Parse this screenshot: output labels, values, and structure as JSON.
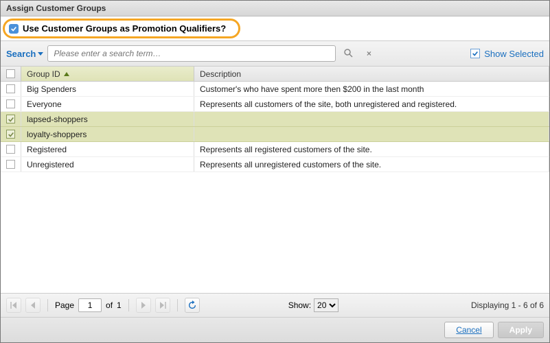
{
  "title": "Assign Customer Groups",
  "qualifier": {
    "checked": true,
    "label": "Use Customer Groups as Promotion Qualifiers?"
  },
  "toolbar": {
    "search_label": "Search",
    "search_placeholder": "Please enter a search term…",
    "show_selected_label": "Show Selected"
  },
  "grid": {
    "headers": {
      "checkbox": "",
      "group_id": "Group ID",
      "description": "Description"
    },
    "sort_column": "group_id",
    "sort_dir": "asc",
    "rows": [
      {
        "selected": false,
        "group_id": "Big Spenders",
        "description": "Customer's who have spent more then $200 in the last month"
      },
      {
        "selected": false,
        "group_id": "Everyone",
        "description": "Represents all customers of the site, both unregistered and registered."
      },
      {
        "selected": true,
        "group_id": "lapsed-shoppers",
        "description": ""
      },
      {
        "selected": true,
        "group_id": "loyalty-shoppers",
        "description": ""
      },
      {
        "selected": false,
        "group_id": "Registered",
        "description": "Represents all registered customers of the site."
      },
      {
        "selected": false,
        "group_id": "Unregistered",
        "description": "Represents all unregistered customers of the site."
      }
    ]
  },
  "pager": {
    "page_label": "Page",
    "page": "1",
    "of_label": "of",
    "total_pages": "1",
    "show_label": "Show:",
    "page_size": "20",
    "displaying": "Displaying 1 - 6 of 6"
  },
  "footer": {
    "cancel": "Cancel",
    "apply": "Apply"
  }
}
